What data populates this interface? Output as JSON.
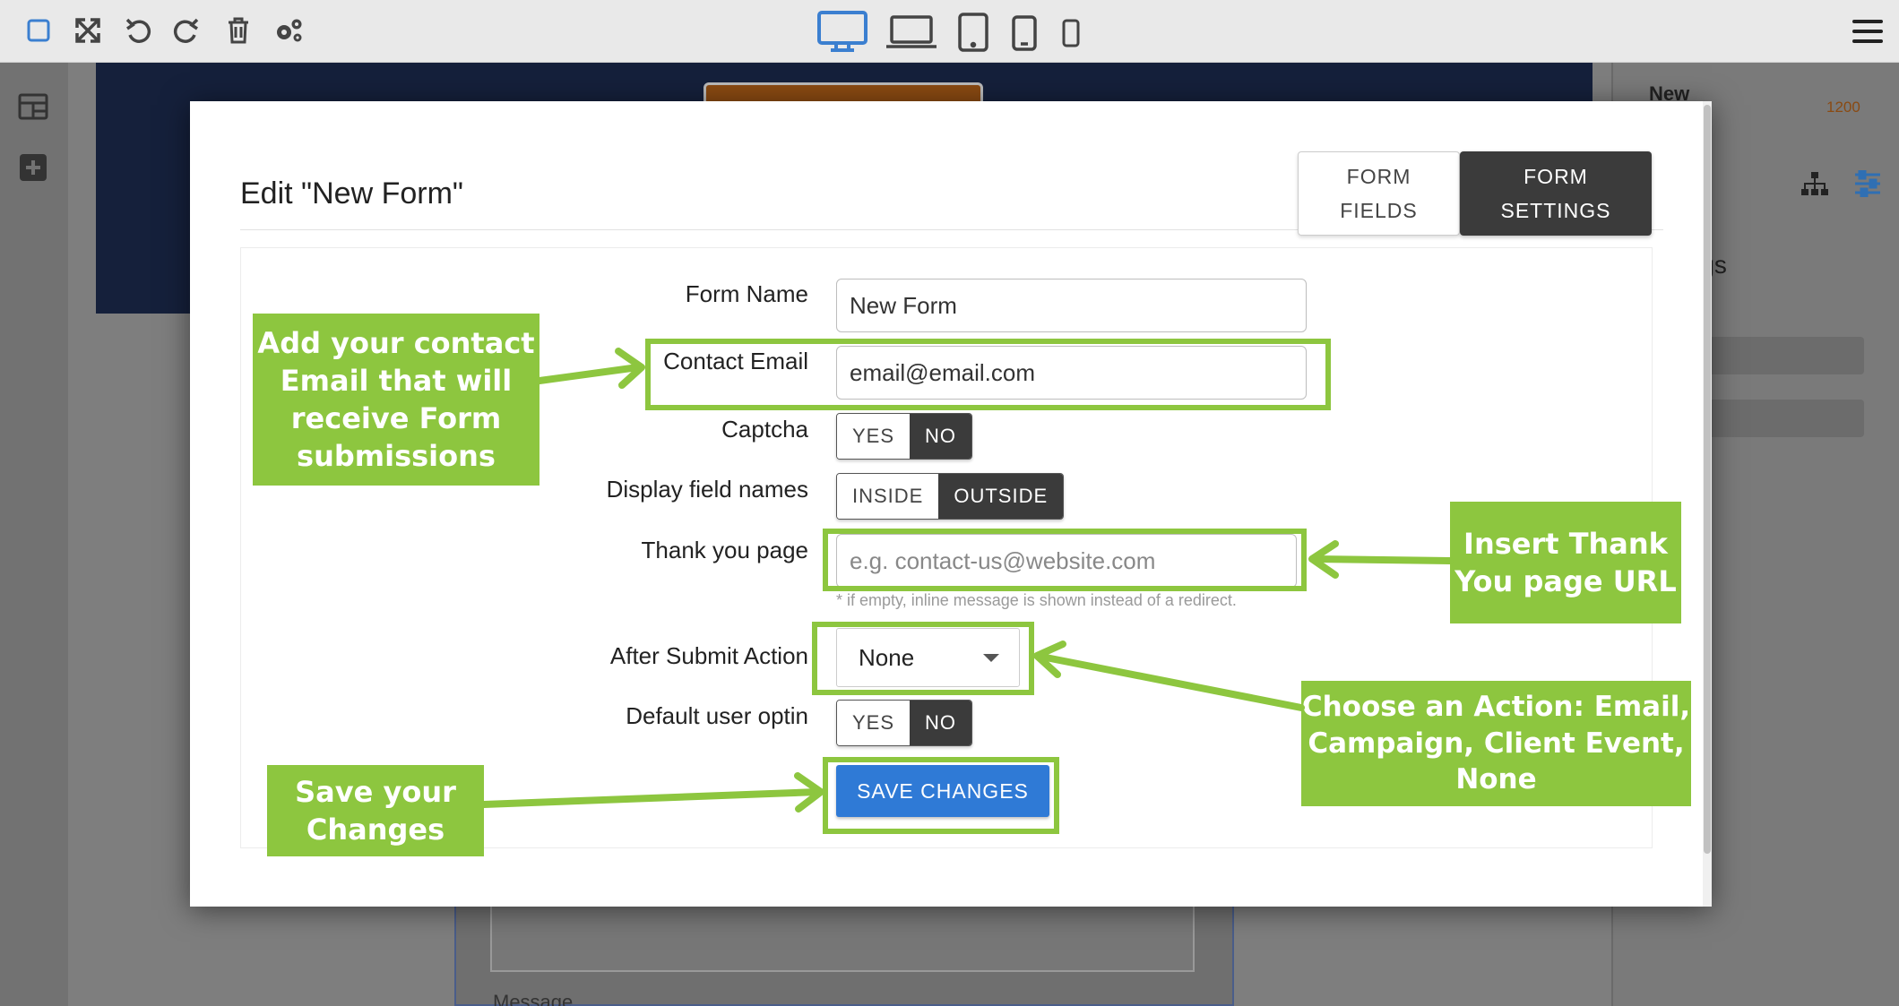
{
  "editor": {
    "toolbar_icons": [
      "square-select-icon",
      "expand-icon",
      "undo-icon",
      "redo-icon",
      "trash-icon",
      "gears-icon"
    ],
    "device_icons": [
      "desktop-icon",
      "laptop-icon",
      "tablet-icon",
      "tablet-small-icon",
      "phone-icon"
    ],
    "right_panel": {
      "title": "New",
      "width_value": "1200",
      "settings_label": "ttings"
    },
    "canvas_field_label": "Message"
  },
  "modal": {
    "title": "Edit \"New Form\"",
    "tabs": [
      {
        "label": "FORM\nFIELDS",
        "active": false
      },
      {
        "label": "FORM\nSETTINGS",
        "active": true
      }
    ],
    "fields": {
      "form_name": {
        "label": "Form Name",
        "value": "New Form"
      },
      "contact_email": {
        "label": "Contact Email",
        "value": "email@email.com"
      },
      "captcha": {
        "label": "Captcha",
        "options": [
          "YES",
          "NO"
        ],
        "selected": "NO"
      },
      "display_field_names": {
        "label": "Display field names",
        "options": [
          "INSIDE",
          "OUTSIDE"
        ],
        "selected": "OUTSIDE"
      },
      "thank_you_page": {
        "label": "Thank you page",
        "placeholder": "e.g. contact-us@website.com",
        "hint": "* if empty, inline message is shown instead of a redirect."
      },
      "after_submit_action": {
        "label": "After Submit Action",
        "value": "None"
      },
      "default_user_optin": {
        "label": "Default user optin",
        "options": [
          "YES",
          "NO"
        ],
        "selected": "NO"
      }
    },
    "save_label": "SAVE CHANGES"
  },
  "annotations": {
    "accent_color": "#8dc63f",
    "contact_email": "Add your contact\nEmail that will\nreceive Form\nsubmissions",
    "thank_you": "Insert Thank\nYou page URL",
    "action": "Choose an Action: Email,\nCampaign, Client Event,\nNone",
    "save": "Save your\nChanges"
  }
}
